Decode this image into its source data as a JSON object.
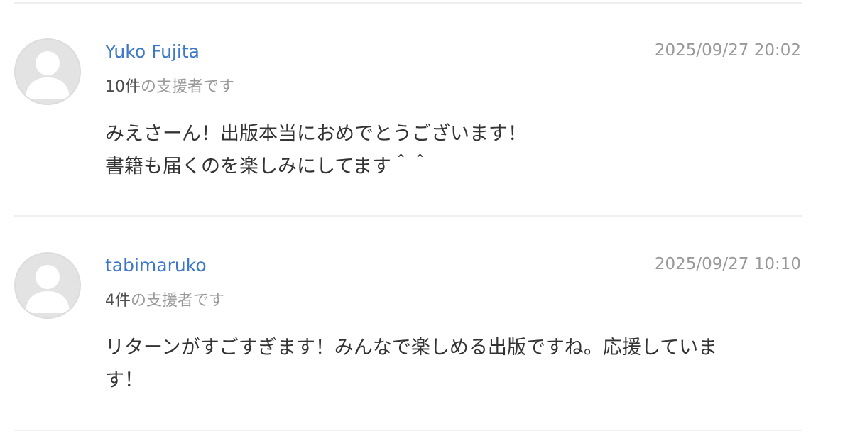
{
  "comments": [
    {
      "author": "Yuko Fujita",
      "timestamp": "2025/09/27 20:02",
      "backer_count": "10件",
      "backer_suffix": "の支援者です",
      "message_lines": [
        "みえさーん！出版本当におめでとうございます！",
        "書籍も届くのを楽しみにしてます＾＾"
      ]
    },
    {
      "author": "tabimaruko",
      "timestamp": "2025/09/27 10:10",
      "backer_count": "4件",
      "backer_suffix": "の支援者です",
      "message_lines": [
        "リターンがすごすぎます！みんなで楽しめる出版ですね。応援していま",
        "す！"
      ]
    }
  ],
  "colors": {
    "author_link": "#3d78c7",
    "timestamp": "#999999",
    "body_text": "#333333",
    "divider": "#efefef",
    "avatar_bg": "#e3e3e3"
  },
  "icons": {
    "avatar": "default-user-avatar-icon"
  }
}
